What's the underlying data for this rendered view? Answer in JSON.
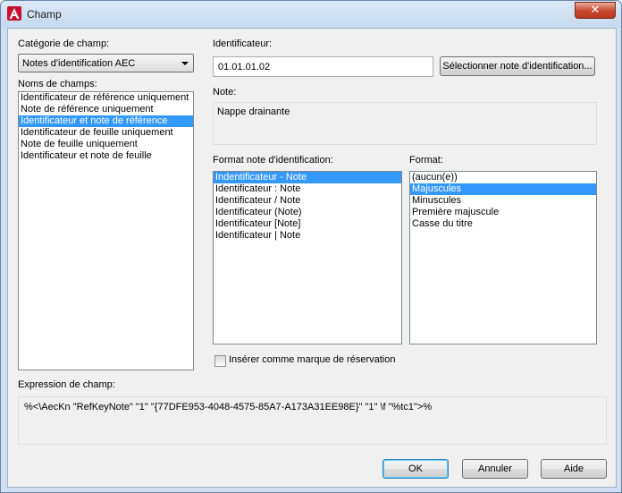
{
  "window": {
    "title": "Champ",
    "close_label": "✕"
  },
  "category": {
    "label": "Catégorie de champ:",
    "selected": "Notes d'identification AEC"
  },
  "field_names": {
    "label": "Noms de champs:",
    "items": [
      "Identificateur de référence uniquement",
      "Note de référence uniquement",
      "Identificateur et note de référence",
      "Identificateur de feuille uniquement",
      "Note de feuille uniquement",
      "Identificateur et note de feuille"
    ],
    "selected_index": 2
  },
  "identifier": {
    "label": "Identificateur:",
    "value": "01.01.01.02",
    "select_button": "Sélectionner note d'identification..."
  },
  "note": {
    "label": "Note:",
    "value": "Nappe drainante"
  },
  "keynote_format": {
    "label": "Format note d'identification:",
    "items": [
      "Indentificateur - Note",
      "Identificateur : Note",
      "Identificateur / Note",
      "Identificateur (Note)",
      "Identificateur [Note]",
      "Identificateur | Note"
    ],
    "selected_index": 0
  },
  "format": {
    "label": "Format:",
    "items": [
      "(aucun(e))",
      "Majuscules",
      "Minuscules",
      "Première majuscule",
      "Casse du titre"
    ],
    "selected_index": 1
  },
  "placeholder_checkbox": {
    "label": "Insérer comme marque de réservation",
    "checked": false
  },
  "expression": {
    "label": "Expression de champ:",
    "value": "%<\\AecKn \"RefKeyNote\" \"1\" \"{77DFE953-4048-4575-85A7-A173A31EE98E}\" \"1\" \\f \"%tc1\">%"
  },
  "buttons": {
    "ok": "OK",
    "cancel": "Annuler",
    "help": "Aide"
  },
  "colors": {
    "selection": "#3399ff",
    "dialog_bg": "#f0f0f0",
    "title_bar": "#cfe0f2",
    "close_button": "#c7472e"
  }
}
